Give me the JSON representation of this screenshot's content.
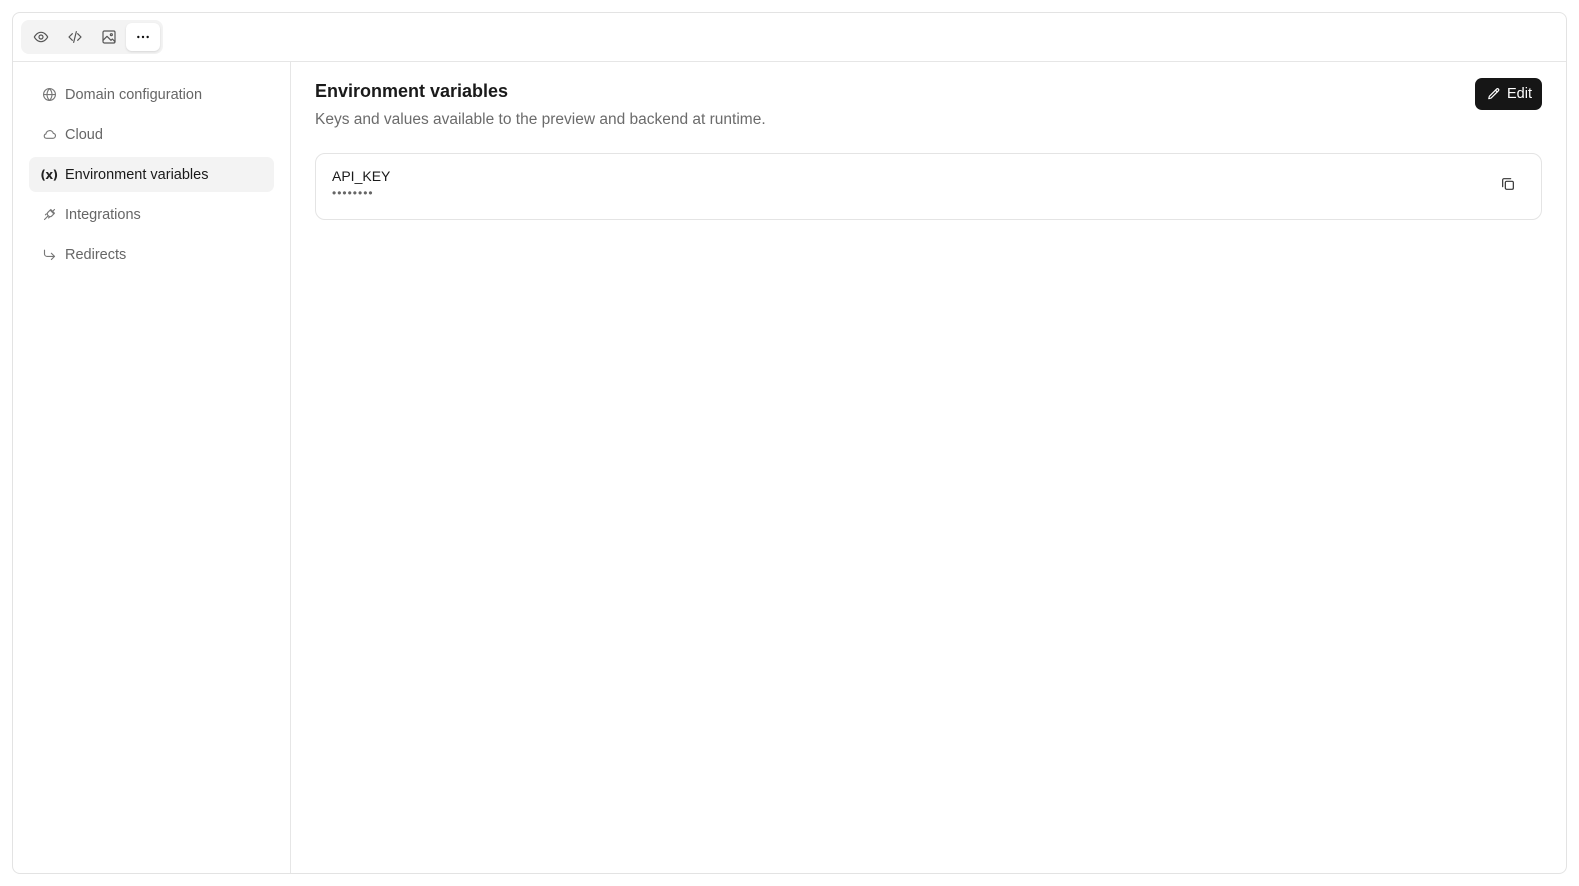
{
  "toolbar": {
    "buttons": [
      {
        "icon": "eye-icon",
        "active": false
      },
      {
        "icon": "code-icon",
        "active": false
      },
      {
        "icon": "image-icon",
        "active": false
      },
      {
        "icon": "more-horizontal-icon",
        "active": true
      }
    ]
  },
  "sidebar": {
    "items": [
      {
        "label": "Domain configuration",
        "icon": "globe-icon",
        "active": false
      },
      {
        "label": "Cloud",
        "icon": "cloud-icon",
        "active": false
      },
      {
        "label": "Environment variables",
        "icon": "variable-icon",
        "icon_text": "(x)",
        "active": true
      },
      {
        "label": "Integrations",
        "icon": "plug-icon",
        "active": false
      },
      {
        "label": "Redirects",
        "icon": "redirect-arrow-icon",
        "active": false
      }
    ]
  },
  "main": {
    "title": "Environment variables",
    "description": "Keys and values available to the preview and backend at runtime.",
    "edit_label": "Edit",
    "variables": [
      {
        "key": "API_KEY",
        "masked_value": "••••••••"
      }
    ]
  },
  "colors": {
    "accent_button": "#161616",
    "active_nav_bg": "#f3f3f3"
  }
}
